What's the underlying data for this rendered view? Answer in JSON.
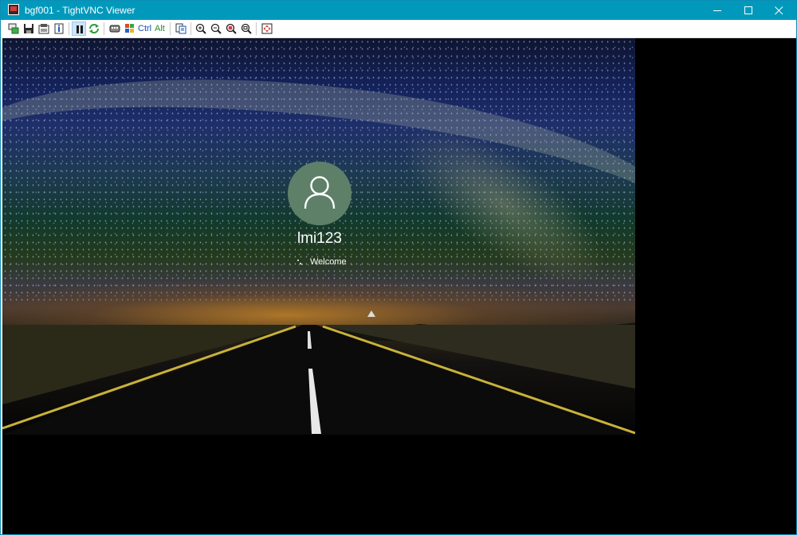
{
  "window": {
    "title": "bgf001 - TightVNC Viewer",
    "accent_color": "#0099bc",
    "controls": [
      "minimize-icon",
      "maximize-icon",
      "close-icon"
    ]
  },
  "toolbar": {
    "ctrl_label": "Ctrl",
    "alt_label": "Alt",
    "buttons": [
      "new-connection-icon",
      "save-icon",
      "options-icon",
      "connection-info-icon",
      "pause-icon",
      "refresh-icon",
      "send-ctrl-alt-del-icon",
      "send-ctrl-esc-icon",
      "ctrl-key",
      "alt-key",
      "transfer-files-icon",
      "zoom-in-icon",
      "zoom-out-icon",
      "zoom-100-icon",
      "zoom-fit-icon",
      "fullscreen-icon"
    ]
  },
  "remote_screen": {
    "username": "lmi123",
    "status": "Welcome",
    "avatar_color": "#5e8069",
    "background_colors": [
      "#14225a",
      "#123a2c",
      "#d28c28",
      "#000000"
    ]
  }
}
